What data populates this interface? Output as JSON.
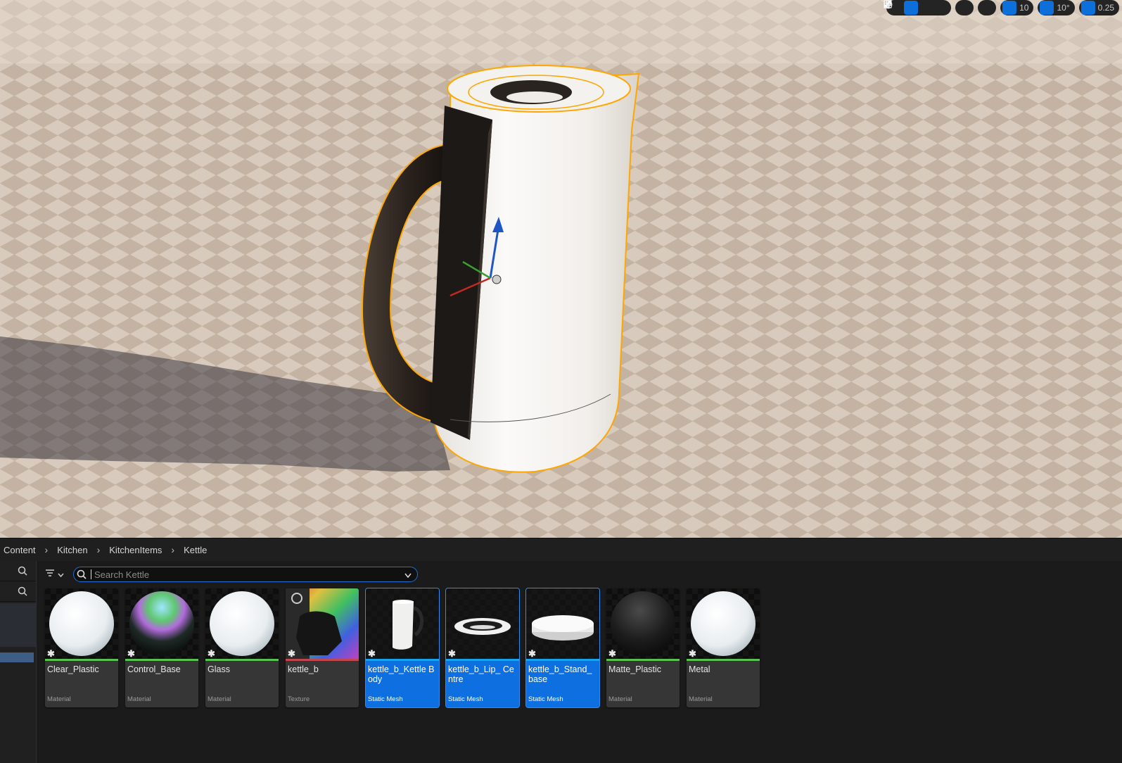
{
  "viewport_toolbar": {
    "tools": [
      {
        "icon": "select-arrow-icon",
        "active": false
      },
      {
        "icon": "move-arrows-icon",
        "active": true
      },
      {
        "icon": "rotate-icon",
        "active": false
      },
      {
        "icon": "scale-icon",
        "active": false
      }
    ],
    "world_icon": "globe-icon",
    "surface_snap_icon": "surface-snap-icon",
    "grid_snap_value": "10",
    "rotation_snap_value": "10°",
    "scale_snap_value": "0.25"
  },
  "breadcrumb": [
    "Content",
    "Kitchen",
    "KitchenItems",
    "Kettle"
  ],
  "search": {
    "placeholder": "Search Kettle",
    "value": ""
  },
  "assets": [
    {
      "name": "Clear_Plastic",
      "type": "Material",
      "selected": false,
      "stripe": "#59c151",
      "thumb": "white-sphere"
    },
    {
      "name": "Control_Base",
      "type": "Material",
      "selected": false,
      "stripe": "#59c151",
      "thumb": "rainbow-sphere"
    },
    {
      "name": "Glass",
      "type": "Material",
      "selected": false,
      "stripe": "#59c151",
      "thumb": "white-sphere"
    },
    {
      "name": "kettle_b",
      "type": "Texture",
      "selected": false,
      "stripe": "#c1464e",
      "thumb": "texture"
    },
    {
      "name": "kettle_b_Kettle Body",
      "type": "Static Mesh",
      "selected": true,
      "stripe": "#18a3f0",
      "thumb": "kettle-body"
    },
    {
      "name": "kettle_b_Lip_ Centre",
      "type": "Static Mesh",
      "selected": true,
      "stripe": "#18a3f0",
      "thumb": "lip-ring"
    },
    {
      "name": "kettle_b_Stand_ base",
      "type": "Static Mesh",
      "selected": true,
      "stripe": "#18a3f0",
      "thumb": "stand-disc"
    },
    {
      "name": "Matte_Plastic",
      "type": "Material",
      "selected": false,
      "stripe": "#59c151",
      "thumb": "black-sphere"
    },
    {
      "name": "Metal",
      "type": "Material",
      "selected": false,
      "stripe": "#59c151",
      "thumb": "white-sphere"
    }
  ]
}
